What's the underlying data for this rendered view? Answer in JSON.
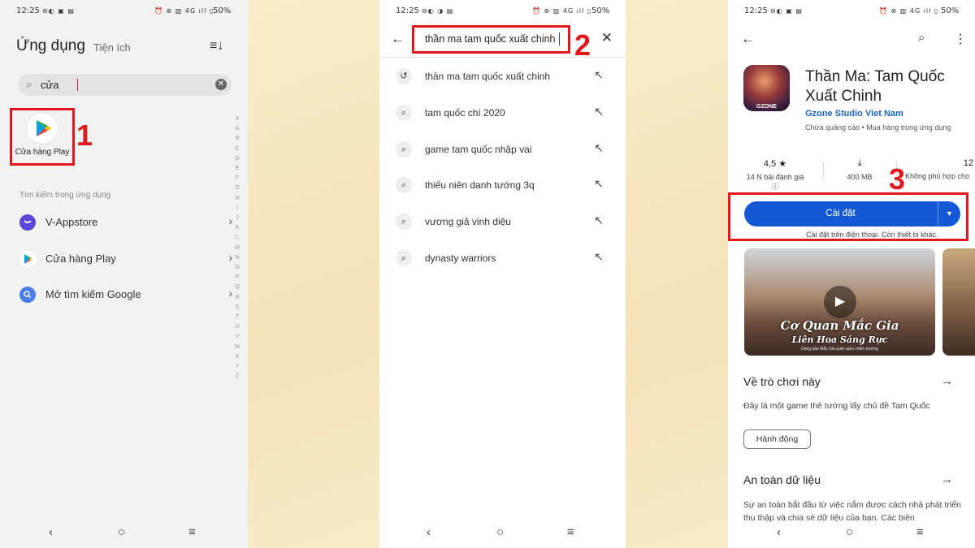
{
  "status_bar": {
    "time": "12:25",
    "battery": "50%"
  },
  "phone1": {
    "tab_apps": "Ứng dụng",
    "tab_widgets": "Tiện ích",
    "search_value": "cửa",
    "app_result_label": "Cửa hàng Play",
    "alphabet": [
      "#",
      "A",
      "B",
      "C",
      "D",
      "E",
      "F",
      "G",
      "H",
      "I",
      "J",
      "K",
      "L",
      "M",
      "N",
      "O",
      "P",
      "Q",
      "R",
      "S",
      "T",
      "U",
      "V",
      "W",
      "X",
      "Y",
      "Z"
    ],
    "section_label": "Tìm kiếm trong ứng dụng",
    "rows": [
      {
        "label": "V-Appstore",
        "color": "#5b47d6"
      },
      {
        "label": "Cửa hàng Play",
        "color": "#ffffff"
      },
      {
        "label": "Mở tìm kiếm Google",
        "color": "#4a7df0"
      }
    ],
    "step": "1"
  },
  "phone2": {
    "query": "thần ma tam quốc xuất chinh",
    "step": "2",
    "suggestions": [
      {
        "text": "thần ma tam quốc xuất chinh",
        "icon": "history-icon"
      },
      {
        "text": "tam quốc chí 2020",
        "icon": "search-icon"
      },
      {
        "text": "game tam quốc nhập vai",
        "icon": "search-icon"
      },
      {
        "text": "thiếu niên danh tướng 3q",
        "icon": "search-icon"
      },
      {
        "text": "vương giả vinh diệu",
        "icon": "search-icon"
      },
      {
        "text": "dynasty warriors",
        "icon": "search-icon"
      }
    ]
  },
  "phone3": {
    "app_icon_text": "GZONE",
    "title": "Thần Ma: Tam Quốc Xuất Chinh",
    "developer": "Gzone Studio Viet Nam",
    "meta_ads": "Chứa quảng cáo",
    "meta_iap": "Mua hàng trong ứng dụng",
    "rating_value": "4,5 ★",
    "rating_count": "14 N bài đánh giá ⓘ",
    "size_value": "400 MB",
    "age_value": "12",
    "age_label": "Không phù hợp cho",
    "install_label": "Cài đặt",
    "install_note": "Cài đặt trên điện thoại. Còn thiết bị khác.",
    "video_caption_1": "Cơ Quan Mắc Gia",
    "video_caption_2": "Liên Hoa Sáng Rực",
    "video_caption_3": "Dùng bảo Mắc Gia quét sạch chiến trường",
    "about_heading": "Về trò chơi này",
    "about_text": "Đây là một game thẻ tướng lấy chủ đề Tam Quốc",
    "genre_chip": "Hành động",
    "safety_heading": "An toàn dữ liệu",
    "safety_text": "Sự an toàn bắt đầu từ việc nắm được cách nhà phát triển thu thập và chia sẻ dữ liệu của bạn. Các biện",
    "step": "3"
  }
}
